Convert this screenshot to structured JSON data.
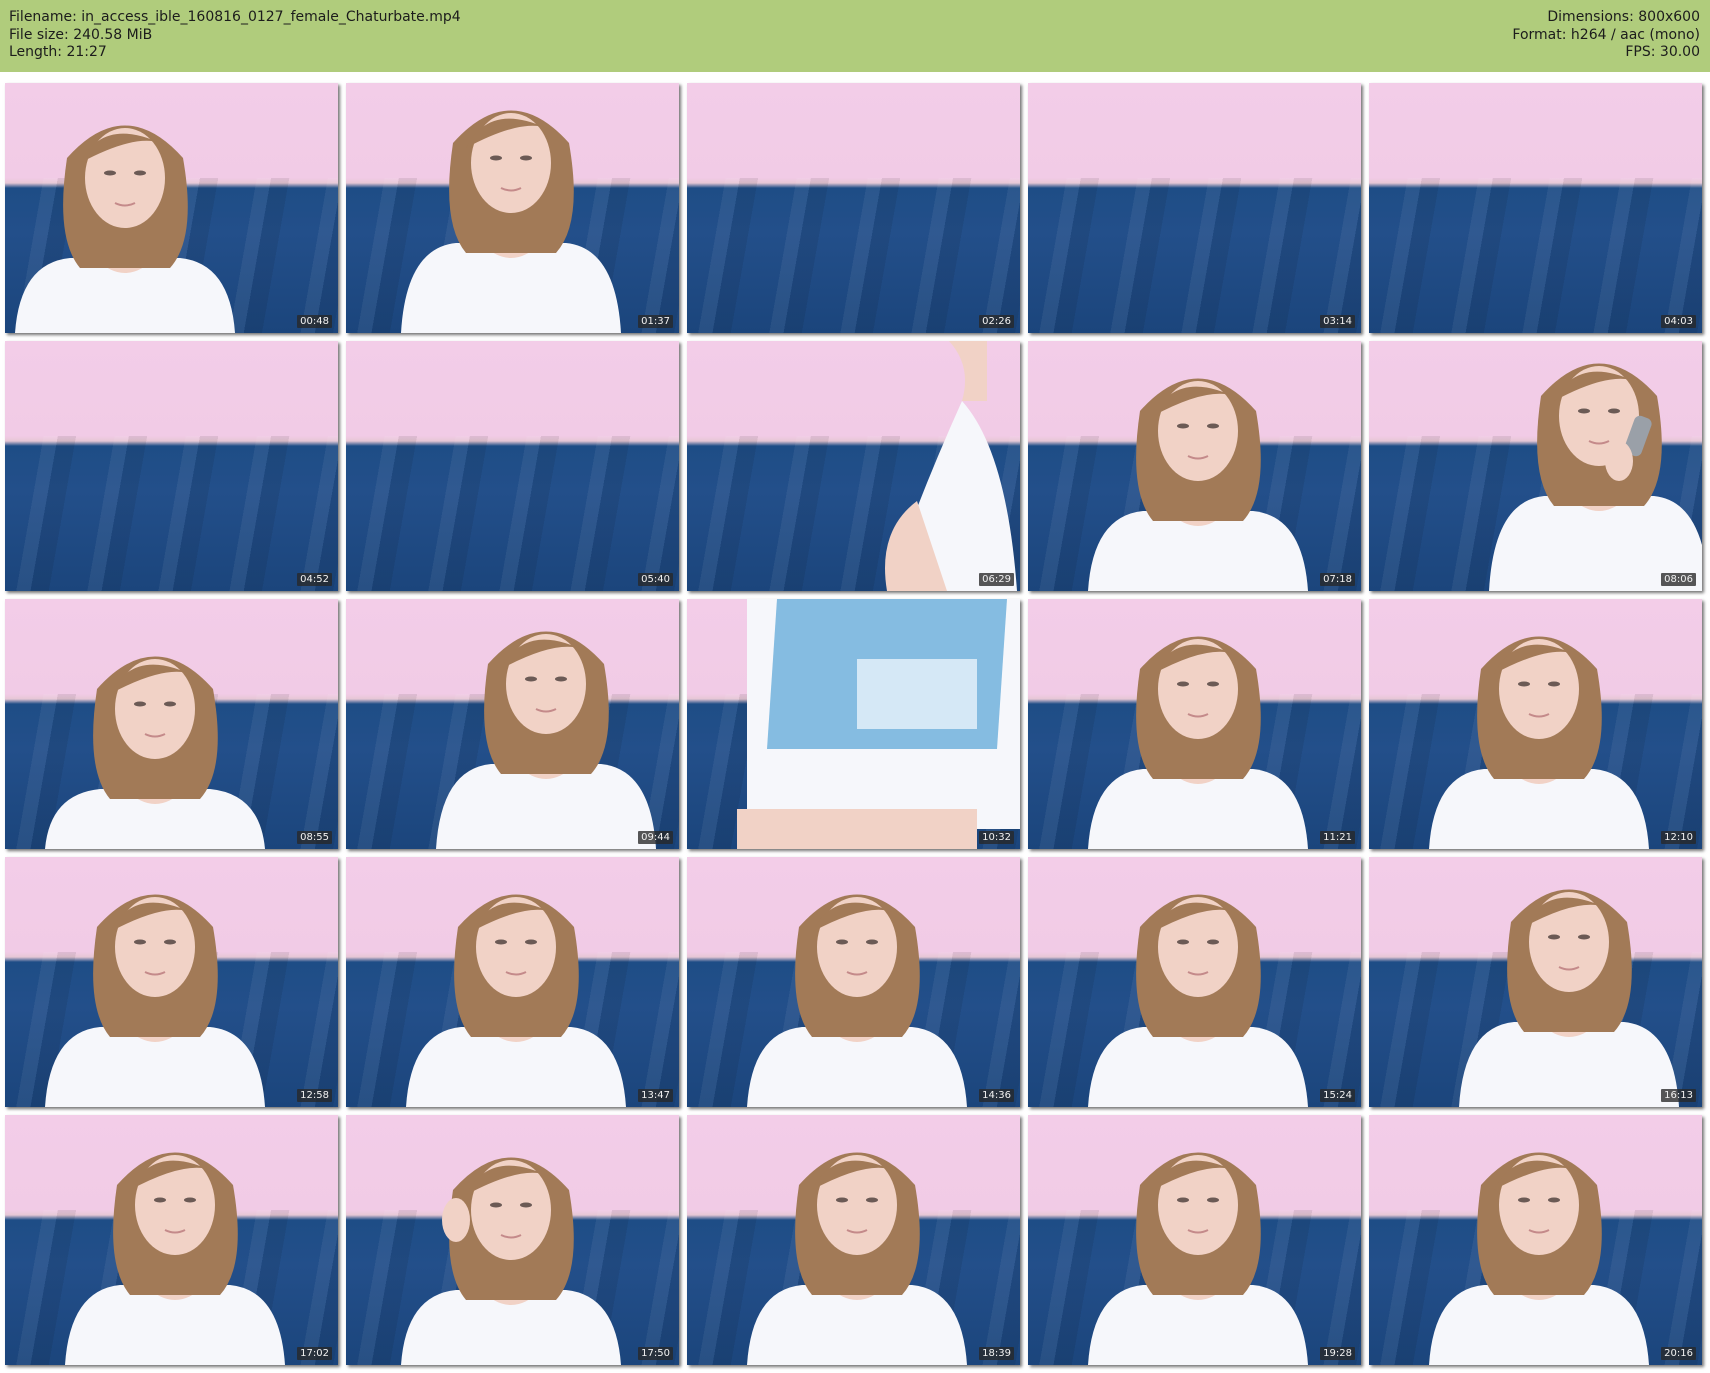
{
  "meta": {
    "filename_label": "Filename: in_access_ible_160816_0127_female_Chaturbate.mp4",
    "filesize_label": "File size: 240.58 MiB",
    "length_label": "Length: 21:27",
    "dimensions_label": "Dimensions: 800x600",
    "format_label": "Format: h264 / aac (mono)",
    "fps_label": "FPS: 30.00"
  },
  "colors": {
    "header_bg": "#b0cc7c",
    "wall": "#f3cde8",
    "sofa": "#1f4c86",
    "shirt": "#f6f7fb",
    "hair": "#a27a57",
    "skin": "#f1d2c6"
  },
  "thumbnails": [
    {
      "time": "00:48",
      "pose": "lean-left"
    },
    {
      "time": "01:37",
      "pose": "lean-center"
    },
    {
      "time": "02:26",
      "pose": "empty"
    },
    {
      "time": "03:14",
      "pose": "empty"
    },
    {
      "time": "04:03",
      "pose": "empty"
    },
    {
      "time": "04:52",
      "pose": "empty"
    },
    {
      "time": "05:40",
      "pose": "empty"
    },
    {
      "time": "06:29",
      "pose": "arm"
    },
    {
      "time": "07:18",
      "pose": "center"
    },
    {
      "time": "08:06",
      "pose": "brush"
    },
    {
      "time": "08:55",
      "pose": "down-left"
    },
    {
      "time": "09:44",
      "pose": "right"
    },
    {
      "time": "10:32",
      "pose": "shirt-closeup"
    },
    {
      "time": "11:21",
      "pose": "center"
    },
    {
      "time": "12:10",
      "pose": "center"
    },
    {
      "time": "12:58",
      "pose": "left"
    },
    {
      "time": "13:47",
      "pose": "center"
    },
    {
      "time": "14:36",
      "pose": "center"
    },
    {
      "time": "15:24",
      "pose": "center"
    },
    {
      "time": "16:13",
      "pose": "right"
    },
    {
      "time": "17:02",
      "pose": "center"
    },
    {
      "time": "17:50",
      "pose": "hand-ear"
    },
    {
      "time": "18:39",
      "pose": "center"
    },
    {
      "time": "19:28",
      "pose": "center"
    },
    {
      "time": "20:16",
      "pose": "center"
    }
  ]
}
